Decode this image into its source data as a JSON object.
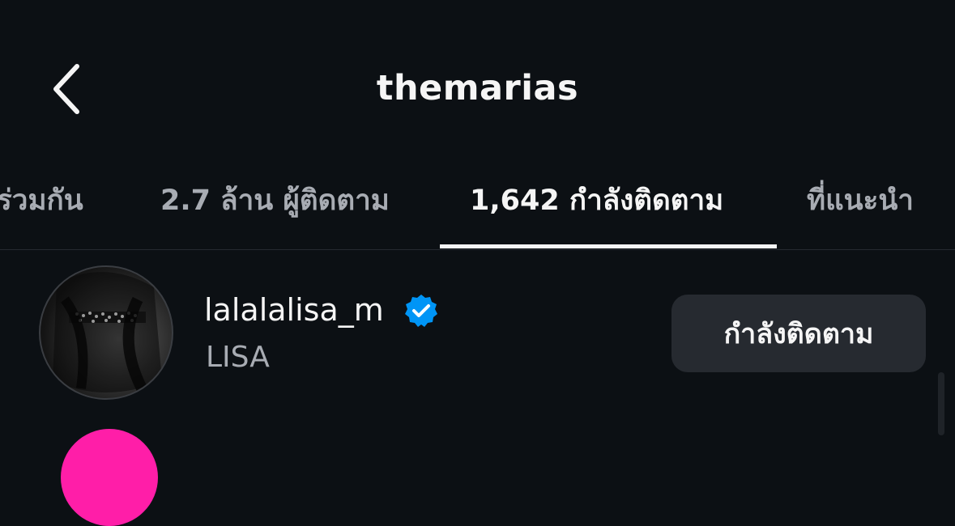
{
  "header": {
    "title": "themarias",
    "back_icon": "chevron-left-icon"
  },
  "tabs": [
    {
      "label": "ร่วมกัน",
      "active": false
    },
    {
      "label": "2.7 ล้าน ผู้ติดตาม",
      "active": false
    },
    {
      "label": "1,642 กำลังติดตาม",
      "active": true
    },
    {
      "label": "ที่แนะนำ",
      "active": false
    }
  ],
  "following_list": [
    {
      "username": "lalalalisa_m",
      "full_name": "LISA",
      "verified": true,
      "verified_icon": "verified-badge-icon",
      "button_label": "กำลังติดตาม"
    }
  ],
  "colors": {
    "background": "#0c1014",
    "text_primary": "#f5f5f5",
    "text_secondary": "#a8acb3",
    "button_bg": "#262a30",
    "verified_blue": "#0095f6"
  }
}
